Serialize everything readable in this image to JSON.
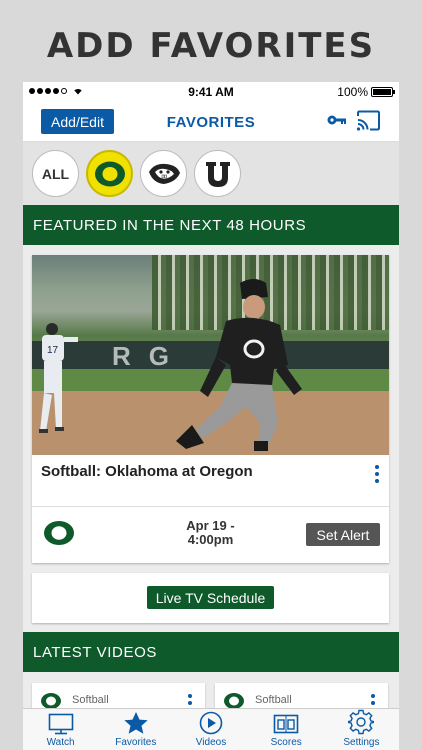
{
  "promo": {
    "title": "ADD FAVORITES"
  },
  "status_bar": {
    "time": "9:41 AM",
    "battery": "100%",
    "battery_level": 1.0
  },
  "nav": {
    "add_edit_label": "Add/Edit",
    "title": "FAVORITES",
    "key_icon": "key-icon",
    "cast_icon": "cast-icon"
  },
  "teams": {
    "all_label": "ALL",
    "selected": "oregon",
    "items": [
      {
        "id": "oregon",
        "icon": "oregon-o-logo",
        "color": "#0f5a2b",
        "bg": "#f1e100"
      },
      {
        "id": "beavers",
        "icon": "beaver-logo"
      },
      {
        "id": "utah",
        "icon": "utah-u-logo"
      }
    ]
  },
  "featured": {
    "header": "FEATURED IN THE NEXT 48 HOURS",
    "event": {
      "title": "Softball: Oklahoma at Oregon",
      "date": "Apr 19 -",
      "time": "4:00pm",
      "alert_label": "Set Alert",
      "photo_banner_text": "RG",
      "jersey_main": "O",
      "jersey_bg": "17"
    },
    "live_tv_label": "Live TV Schedule"
  },
  "latest": {
    "header": "LATEST VIDEOS",
    "videos": [
      {
        "category": "Softball"
      },
      {
        "category": "Softball"
      }
    ]
  },
  "tabs": [
    {
      "label": "Watch",
      "icon": "tv-icon"
    },
    {
      "label": "Favorites",
      "icon": "star-icon",
      "active": true
    },
    {
      "label": "Videos",
      "icon": "play-icon"
    },
    {
      "label": "Scores",
      "icon": "scoreboard-icon"
    },
    {
      "label": "Settings",
      "icon": "gear-icon"
    }
  ],
  "colors": {
    "oregon_green": "#0f5a2b",
    "oregon_yellow": "#f1e100",
    "accent_blue": "#0b5aa6"
  }
}
